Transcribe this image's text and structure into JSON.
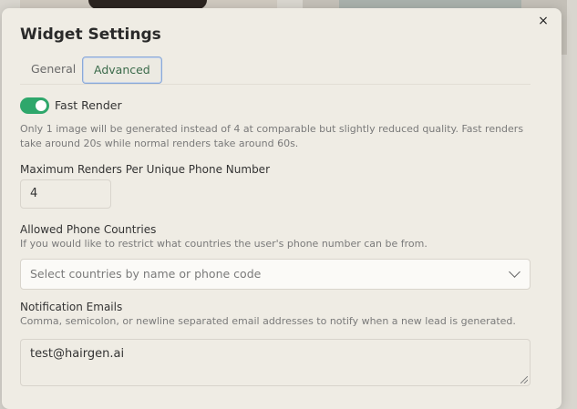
{
  "dialog": {
    "title": "Widget Settings",
    "close_icon": "close-icon",
    "close_glyph": "×"
  },
  "tabs": [
    {
      "label": "General",
      "active": false
    },
    {
      "label": "Advanced",
      "active": true
    }
  ],
  "fast_render": {
    "label": "Fast Render",
    "enabled": true,
    "help": "Only 1 image will be generated instead of 4 at comparable but slightly reduced quality. Fast renders take around 20s while normal renders take around 60s."
  },
  "max_renders": {
    "label": "Maximum Renders Per Unique Phone Number",
    "value": "4"
  },
  "allowed_countries": {
    "label": "Allowed Phone Countries",
    "help": "If you would like to restrict what countries the user's phone number can be from.",
    "placeholder": "Select countries by name or phone code",
    "icon": "chevron-down-icon"
  },
  "notification_emails": {
    "label": "Notification Emails",
    "help": "Comma, semicolon, or newline separated email addresses to notify when a new lead is generated.",
    "value": "test@hairgen.ai"
  },
  "colors": {
    "toggle_on": "#2ea76b",
    "modal_bg": "#efece4",
    "tab_active_border": "#8aa9d8"
  }
}
